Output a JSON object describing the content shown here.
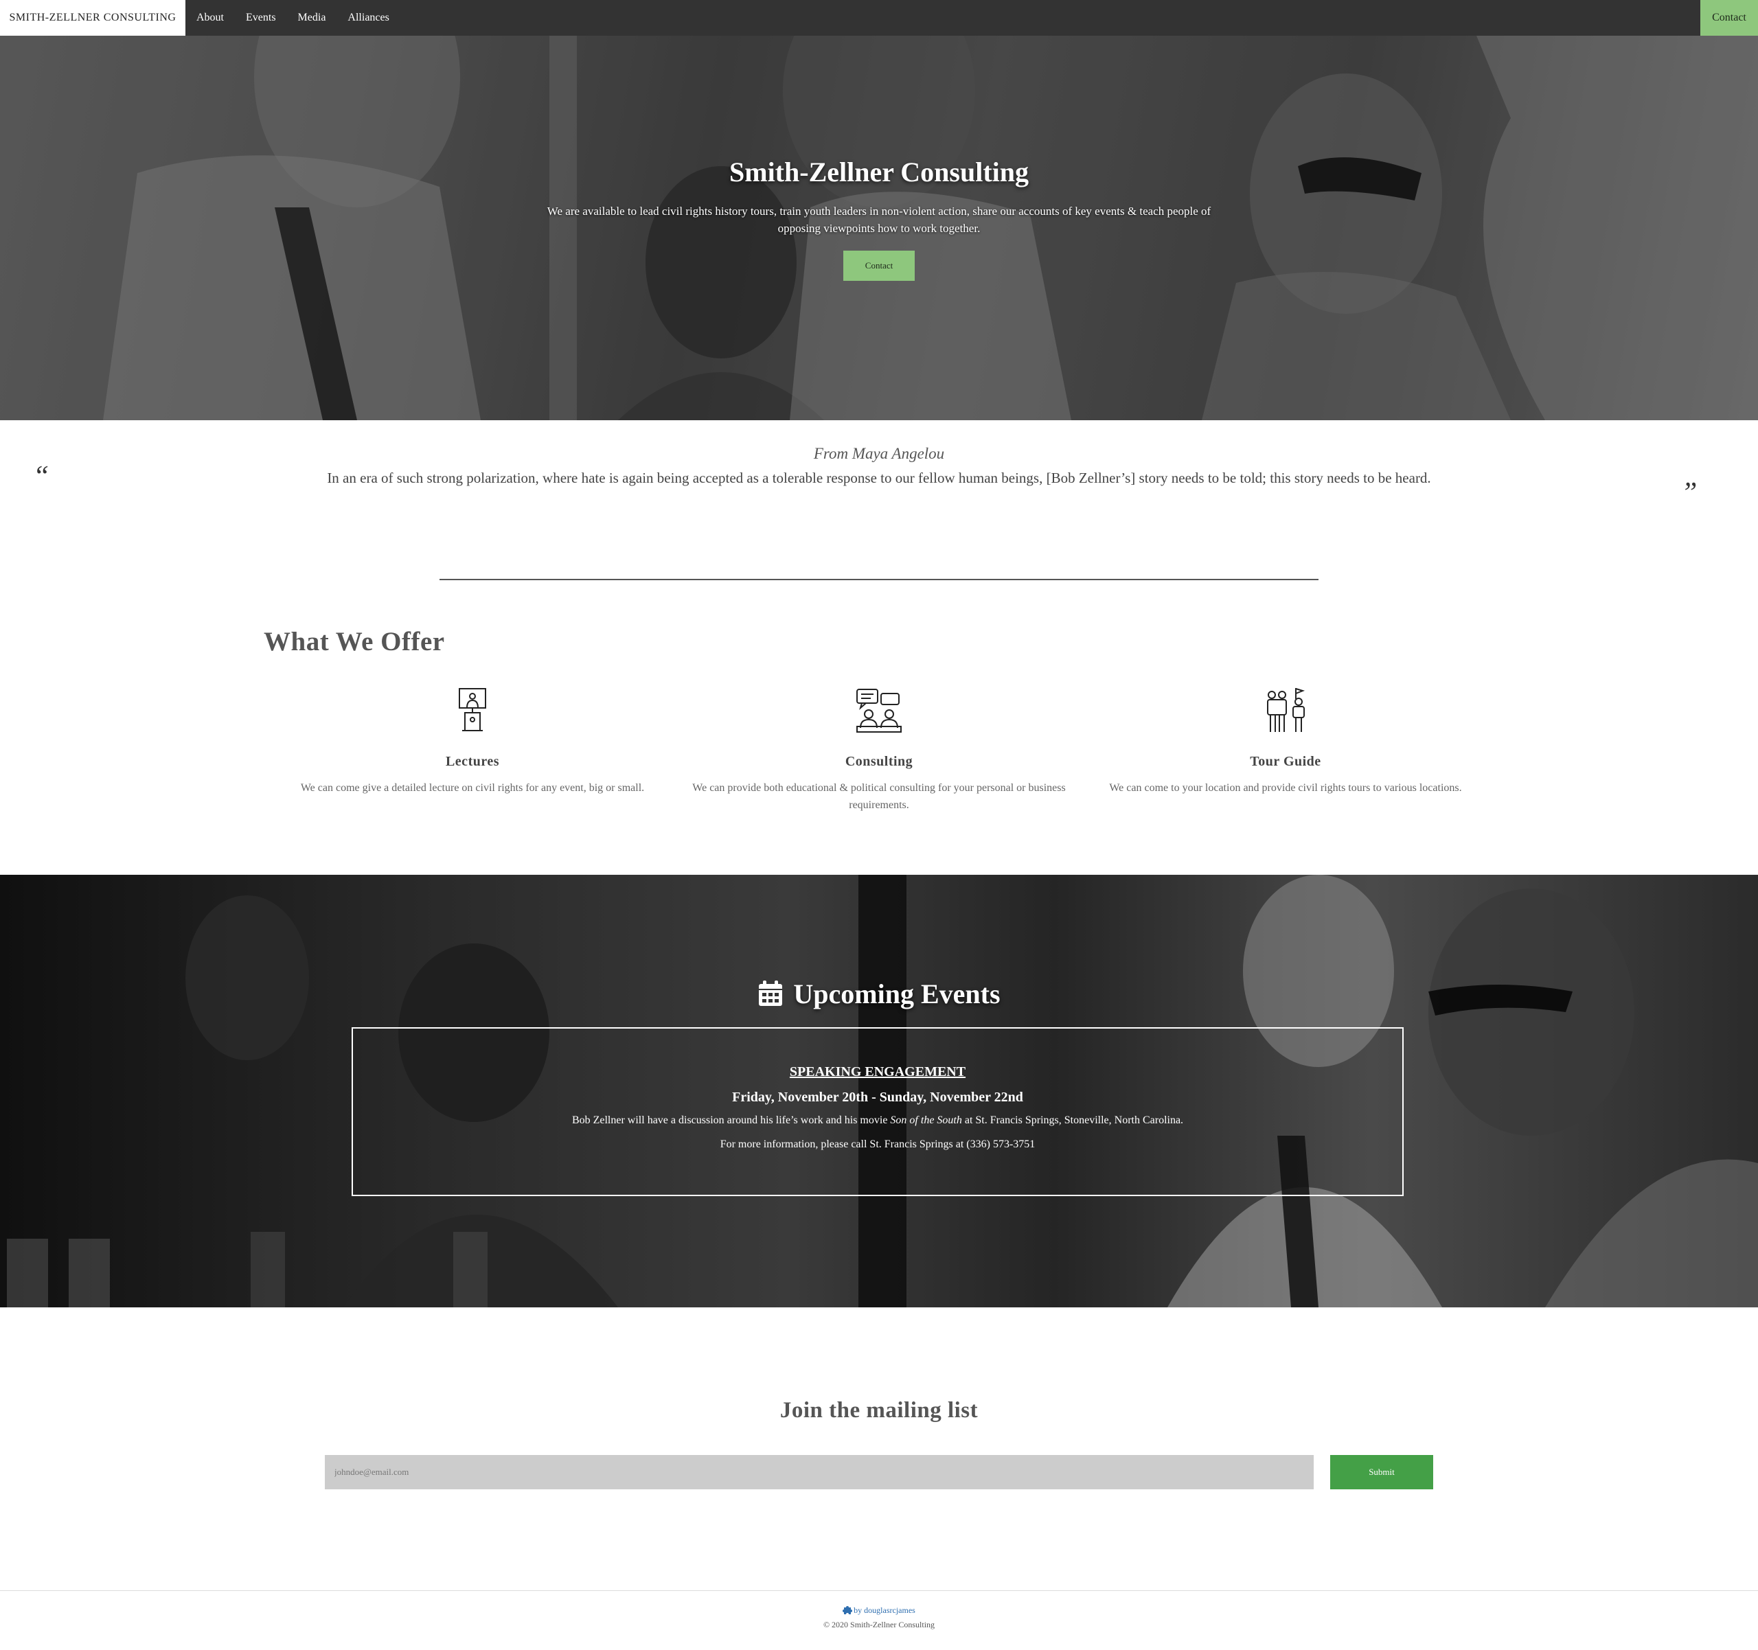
{
  "nav": {
    "brand": "SMITH-ZELLNER CONSULTING",
    "links": [
      "About",
      "Events",
      "Media",
      "Alliances"
    ],
    "contact": "Contact"
  },
  "hero": {
    "title": "Smith-Zellner Consulting",
    "subtitle": "We are available to lead civil rights history tours, train youth leaders in non-violent action, share our accounts of key events & teach people of opposing viewpoints how to work together.",
    "button": "Contact"
  },
  "quote": {
    "open_mark": "“",
    "close_mark": "”",
    "source": "From Maya Angelou",
    "text": "In an era of such strong polarization, where hate is again being accepted as a tolerable response to our fellow human beings, [Bob Zellner’s] story needs to be told; this story needs to be heard."
  },
  "offer": {
    "title": "What We Offer",
    "items": [
      {
        "icon": "lecture-podium-icon",
        "name": "Lectures",
        "desc": "We can come give a detailed lecture on civil rights for any event, big or small."
      },
      {
        "icon": "consulting-meeting-icon",
        "name": "Consulting",
        "desc": "We can provide both educational & political consulting for your personal or business requirements."
      },
      {
        "icon": "tour-guide-icon",
        "name": "Tour Guide",
        "desc": "We can come to your location and provide civil rights tours to various locations."
      }
    ]
  },
  "events": {
    "icon": "calendar-icon",
    "title": "Upcoming Events",
    "type": "SPEAKING ENGAGEMENT",
    "date": "Friday, November 20th - Sunday, November 22nd",
    "desc_before": "Bob Zellner will have a discussion around his life’s work and his movie ",
    "desc_film": "Son of the South",
    "desc_after": " at St. Francis Springs, Stoneville, North Carolina.",
    "info": "For more information, please call St. Francis Springs at (336) 573-3751"
  },
  "mailing": {
    "title": "Join the mailing list",
    "placeholder": "johndoe@email.com",
    "value": "",
    "button": "Submit"
  },
  "footer": {
    "by": "by douglasrcjames",
    "copyright": "© 2020 Smith-Zellner Consulting"
  },
  "colors": {
    "nav_bg": "#333333",
    "accent_green": "#8ec77d",
    "submit_green": "#44a047",
    "footer_link": "#2f6fb0"
  }
}
